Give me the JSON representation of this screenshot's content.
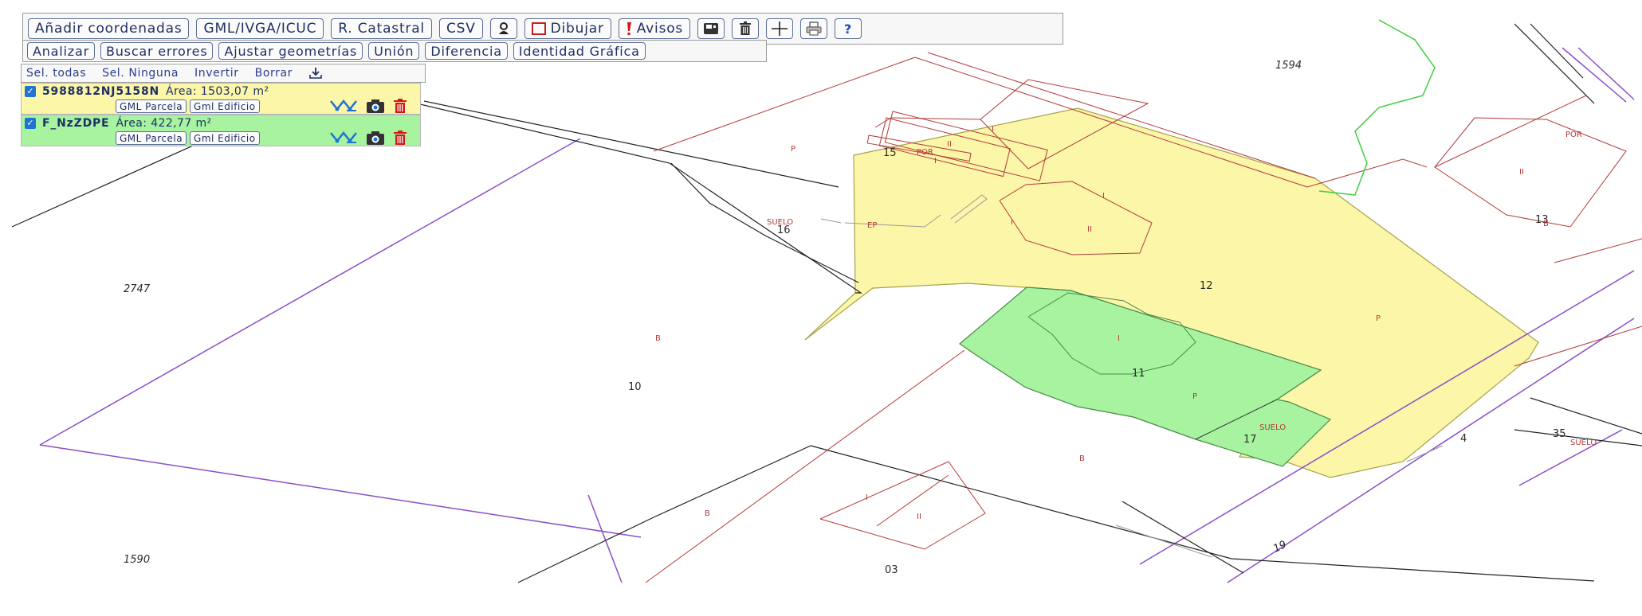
{
  "toolbar": {
    "add_coords_label": "Añadir coordenadas",
    "gml_label": "GML/IVGA/ICUC",
    "catastral_label": "R. Catastral",
    "csv_label": "CSV",
    "draw_label": "Dibujar",
    "warnings_label": "Avisos",
    "icons": [
      "locate-icon",
      "draw-rect-icon",
      "warning-icon",
      "save-icon",
      "trash-icon",
      "crosshair-icon",
      "print-icon",
      "help-icon"
    ]
  },
  "analysis": {
    "analyze_label": "Analizar",
    "find_errors_label": "Buscar errores",
    "adjust_label": "Ajustar geometrías",
    "union_label": "Unión",
    "difference_label": "Diferencia",
    "identity_label": "Identidad Gráfica"
  },
  "selection": {
    "select_all": "Sel. todas",
    "select_none": "Sel. Ninguna",
    "invert": "Invertir",
    "delete": "Borrar"
  },
  "parcels": [
    {
      "id": "5988812NJ5158N",
      "area_label": "Área:",
      "area_value": "1503,07 m²",
      "gml_parcel": "GML Parcela",
      "gml_building": "Gml Edificio",
      "color": "#fbf6a8"
    },
    {
      "id": "F_NzZDPE",
      "area_label": "Área:",
      "area_value": "422,77 m²",
      "gml_parcel": "GML Parcela",
      "gml_building": "Gml Edificio",
      "color": "#a7f3a0"
    }
  ],
  "map_labels": {
    "p1594": "1594",
    "p2747": "2747",
    "p1590": "1590",
    "p10": "10",
    "p12": "12",
    "p11": "11",
    "p16": "16",
    "p15": "15",
    "p17": "17",
    "p13": "13",
    "p03": "03",
    "p35": "35",
    "p4": "4",
    "p19": "19",
    "suelo_a": "SUELO",
    "suelo_b": "SUELO",
    "suelo_c": "SUELO",
    "por_a": "POR",
    "por_b": "POR",
    "ep": "EP",
    "ii_a": "II",
    "ii_b": "II",
    "ii_c": "II",
    "ii_d": "II",
    "i_a": "I",
    "i_b": "I",
    "i_c": "I",
    "i_d": "I",
    "i_e": "I",
    "i_f": "I",
    "p_a": "P",
    "p_b": "P",
    "p_c": "P",
    "b_a": "B",
    "b_b": "B",
    "b_c": "B",
    "b_d": "B"
  },
  "colors": {
    "parcel_yellow": "#fbf6a8",
    "parcel_green": "#a7f3a0",
    "cadastral_red": "#b33a3a",
    "road_purple": "#8a4fc7",
    "river_green": "#3ccf3c",
    "accent_blue": "#1f2f66"
  }
}
